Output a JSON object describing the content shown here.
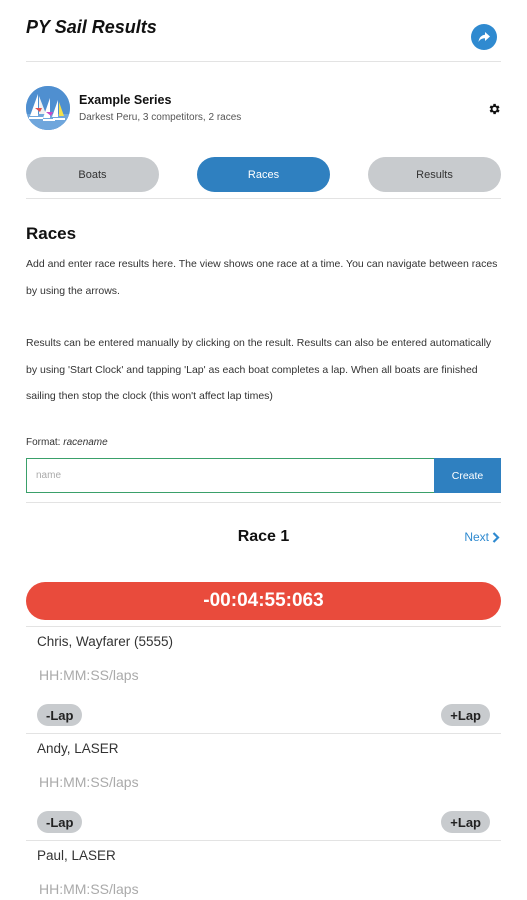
{
  "header": {
    "title": "PY Sail Results",
    "share_icon": "share-icon"
  },
  "series": {
    "name": "Example Series",
    "subtitle": "Darkest Peru, 3 competitors, 2 races",
    "settings_icon": "gear-icon"
  },
  "tabs": [
    {
      "label": "Boats",
      "active": false
    },
    {
      "label": "Races",
      "active": true
    },
    {
      "label": "Results",
      "active": false
    }
  ],
  "races": {
    "title": "Races",
    "intro_1": "Add and enter race results here. The view shows one race at a time. You can navigate between races by using the arrows.",
    "intro_2": "Results can be entered manually by clicking on the result. Results can also be entered automatically by using 'Start Clock' and tapping 'Lap' as each boat completes a lap. When all boats are finished sailing then stop the clock (this won't affect lap times)",
    "format_label": "Format:",
    "format_value": "racename",
    "name_placeholder": "name",
    "create_label": "Create"
  },
  "race": {
    "title": "Race 1",
    "next_label": "Next",
    "clock": "-00:04:55:063"
  },
  "competitors": [
    {
      "name": "Chris, Wayfarer (5555)",
      "time_placeholder": "HH:MM:SS/laps",
      "minus_label": "-Lap",
      "plus_label": "+Lap"
    },
    {
      "name": "Andy, LASER",
      "time_placeholder": "HH:MM:SS/laps",
      "minus_label": "-Lap",
      "plus_label": "+Lap"
    },
    {
      "name": "Paul, LASER",
      "time_placeholder": "HH:MM:SS/laps"
    }
  ],
  "colors": {
    "accent": "#2f80c0",
    "clock_bg": "#e94b3c",
    "tab_inactive": "#c8cbce"
  }
}
